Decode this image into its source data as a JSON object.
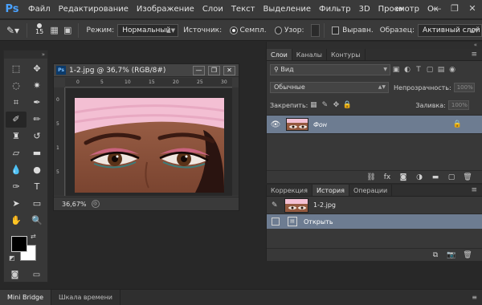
{
  "app": {
    "logo": "Ps"
  },
  "menu": [
    "Файл",
    "Редактирование",
    "Изображение",
    "Слои",
    "Текст",
    "Выделение",
    "Фильтр",
    "3D",
    "Просмотр",
    "Ок"
  ],
  "window_controls": {
    "minimize": "—",
    "restore": "❐",
    "close": "✕"
  },
  "options": {
    "brush_size": "15",
    "mode_label": "Режим:",
    "mode_value": "Нормальный",
    "source_label": "Источник:",
    "source_sampled": "Семпл.",
    "source_pattern": "Узор:",
    "aligned_label": "Выравн.",
    "sample_label": "Образец:",
    "sample_value": "Активный слой"
  },
  "document": {
    "title": "1-2.jpg @ 36,7% (RGB/8#)",
    "zoom": "36,67%",
    "ruler_h": [
      "0",
      "5",
      "10",
      "15",
      "20",
      "25",
      "30"
    ],
    "ruler_v": [
      "0",
      "5",
      "1",
      "5"
    ]
  },
  "layers_panel": {
    "tabs": [
      "Слои",
      "Каналы",
      "Контуры"
    ],
    "active_tab": "Слои",
    "filter_value": "Вид",
    "blend_mode": "Обычные",
    "opacity_label": "Непрозрачность:",
    "opacity_value": "100%",
    "lock_label": "Закрепить:",
    "fill_label": "Заливка:",
    "fill_value": "100%",
    "layer_name": "Фон",
    "selection_color": "#6d7c91"
  },
  "history_panel": {
    "tabs": [
      "Коррекция",
      "История",
      "Операции"
    ],
    "active_tab": "История",
    "snapshot_name": "1-2.jpg",
    "state_name": "Открыть"
  },
  "bottom_tabs": [
    "Mini Bridge",
    "Шкала времени"
  ],
  "active_bottom_tab": "Mini Bridge",
  "colors": {
    "foreground": "#000000",
    "background": "#ffffff",
    "ps_blue": "#4aa2ff"
  }
}
